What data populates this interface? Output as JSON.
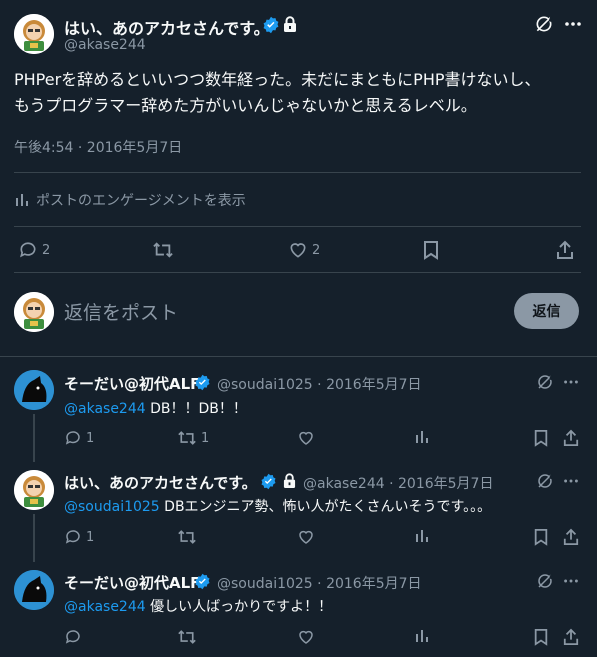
{
  "main_post": {
    "author_name": "はい、あのアカセさんです。",
    "author_handle": "@akase244",
    "text_line1": "PHPerを辞めるといいつつ数年経った。未だにまともにPHP書けないし、",
    "text_line2": "もうプログラマー辞めた方がいいんじゃないかと思えるレベル。",
    "timestamp": "午後4:54 · 2016年5月7日",
    "engagement_label": "ポストのエンゲージメントを表示",
    "reply_count": "2",
    "like_count": "2"
  },
  "composer": {
    "placeholder": "返信をポスト",
    "button_label": "返信"
  },
  "replies": [
    {
      "author_name": "そーだい@初代ALF",
      "author_handle": "@soudai1025",
      "date": "2016年5月7日",
      "mention": "@akase244",
      "text": " DB！！DB！！",
      "reply_count": "1",
      "retweet_count": "1"
    },
    {
      "author_name": "はい、あのアカセさんです。",
      "author_handle": "@akase244",
      "date": "2016年5月7日",
      "mention": "@soudai1025",
      "text": " DBエンジニア勢、怖い人がたくさんいそうです。。。",
      "reply_count": "1"
    },
    {
      "author_name": "そーだい@初代ALF",
      "author_handle": "@soudai1025",
      "date": "2016年5月7日",
      "mention": "@akase244",
      "text": " 優しい人ばっかりですよ！！"
    }
  ],
  "separator": " · ",
  "colors": {
    "background": "#15202b",
    "text_primary": "#f7f9f9",
    "text_secondary": "#8b98a5",
    "accent": "#1d9bf0",
    "divider": "#38444d"
  },
  "icons": [
    "verified-badge-icon",
    "lock-icon",
    "grok-icon",
    "more-icon",
    "reply-icon",
    "retweet-icon",
    "like-icon",
    "bookmark-icon",
    "share-icon",
    "views-icon"
  ]
}
